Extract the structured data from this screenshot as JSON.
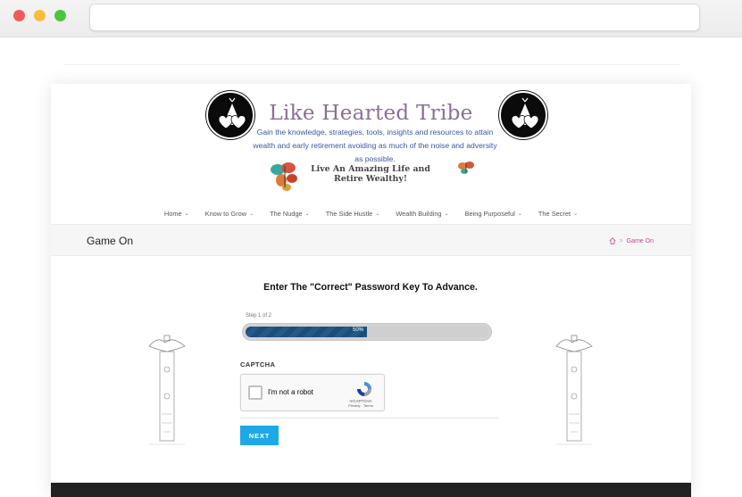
{
  "browser": {
    "buttons": [
      "close",
      "minimize",
      "maximize"
    ],
    "url": ""
  },
  "header": {
    "site_title": "Like Hearted Tribe",
    "tagline": "Gain the knowledge, strategies, tools, insights and resources to attain wealth and early retirement avoiding as much of the noise and adversity as possible.",
    "slogan": "Live An Amazing Life and Retire Wealthy!"
  },
  "nav": {
    "items": [
      {
        "label": "Home"
      },
      {
        "label": "Know to Grow"
      },
      {
        "label": "The Nudge"
      },
      {
        "label": "The Side Hustle"
      },
      {
        "label": "Wealth Building"
      },
      {
        "label": "Being Purposeful"
      },
      {
        "label": "The Secret"
      }
    ],
    "chevron_icon": "chevron-down-icon"
  },
  "page_header": {
    "title": "Game On",
    "breadcrumb": {
      "home_icon": "home-icon",
      "separator": ">",
      "current": "Game On"
    }
  },
  "form": {
    "heading": "Enter The \"Correct\" Password Key To Advance.",
    "step_label": "Step 1 of 2",
    "progress": 0.5,
    "progress_text": "50%",
    "captcha_label": "CAPTCHA",
    "recaptcha": {
      "checkbox_label": "I'm not a robot",
      "brand": "reCAPTCHA",
      "links": "Privacy - Terms"
    },
    "next_button": "NEXT"
  },
  "colors": {
    "title": "#8b6e95",
    "tagline": "#3c55a8",
    "breadcrumb": "#c0468f",
    "progress_fill": "#1d4e7a",
    "button": "#1ea8e7",
    "footer": "#222222"
  }
}
